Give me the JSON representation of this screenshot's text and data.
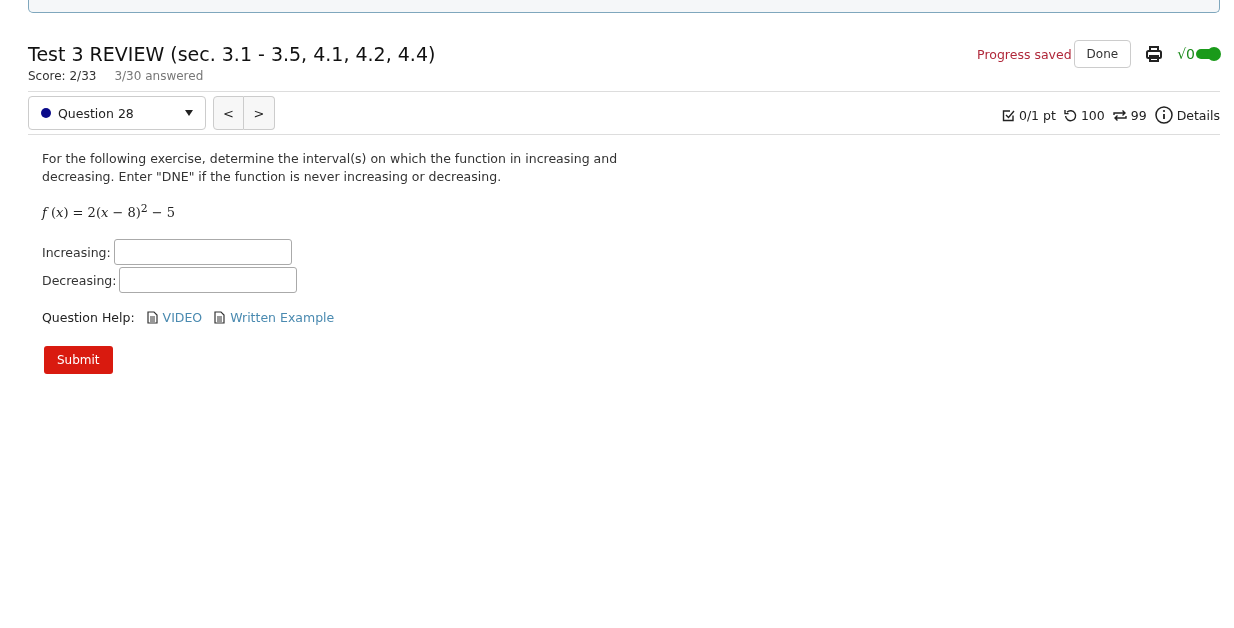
{
  "header": {
    "title": "Test 3 REVIEW (sec. 3.1 - 3.5, 4.1, 4.2, 4.4)",
    "score": "Score: 2/33",
    "answered": "3/30 answered",
    "status": "Progress saved",
    "done_button": "Done",
    "math_toggle": {
      "label": "√0",
      "on": true
    }
  },
  "question_nav": {
    "selector": "Question 28",
    "prev": "<",
    "next": ">",
    "points": "0/1 pt",
    "retries": "100",
    "attempts": "99",
    "details": "Details"
  },
  "question": {
    "text": "For the following exercise, determine the interval(s) on which the function in increasing and decreasing. Enter \"DNE\" if the function is never increasing or decreasing.",
    "formula": "*f* (*x*) = 2(*x* − 8)$^{2}$ − 5",
    "fields": [
      {
        "label": "Increasing:"
      },
      {
        "label": "Decreasing:"
      }
    ],
    "help_label": "Question Help:",
    "help_links": [
      "VIDEO",
      "Written Example"
    ],
    "submit": "Submit"
  }
}
